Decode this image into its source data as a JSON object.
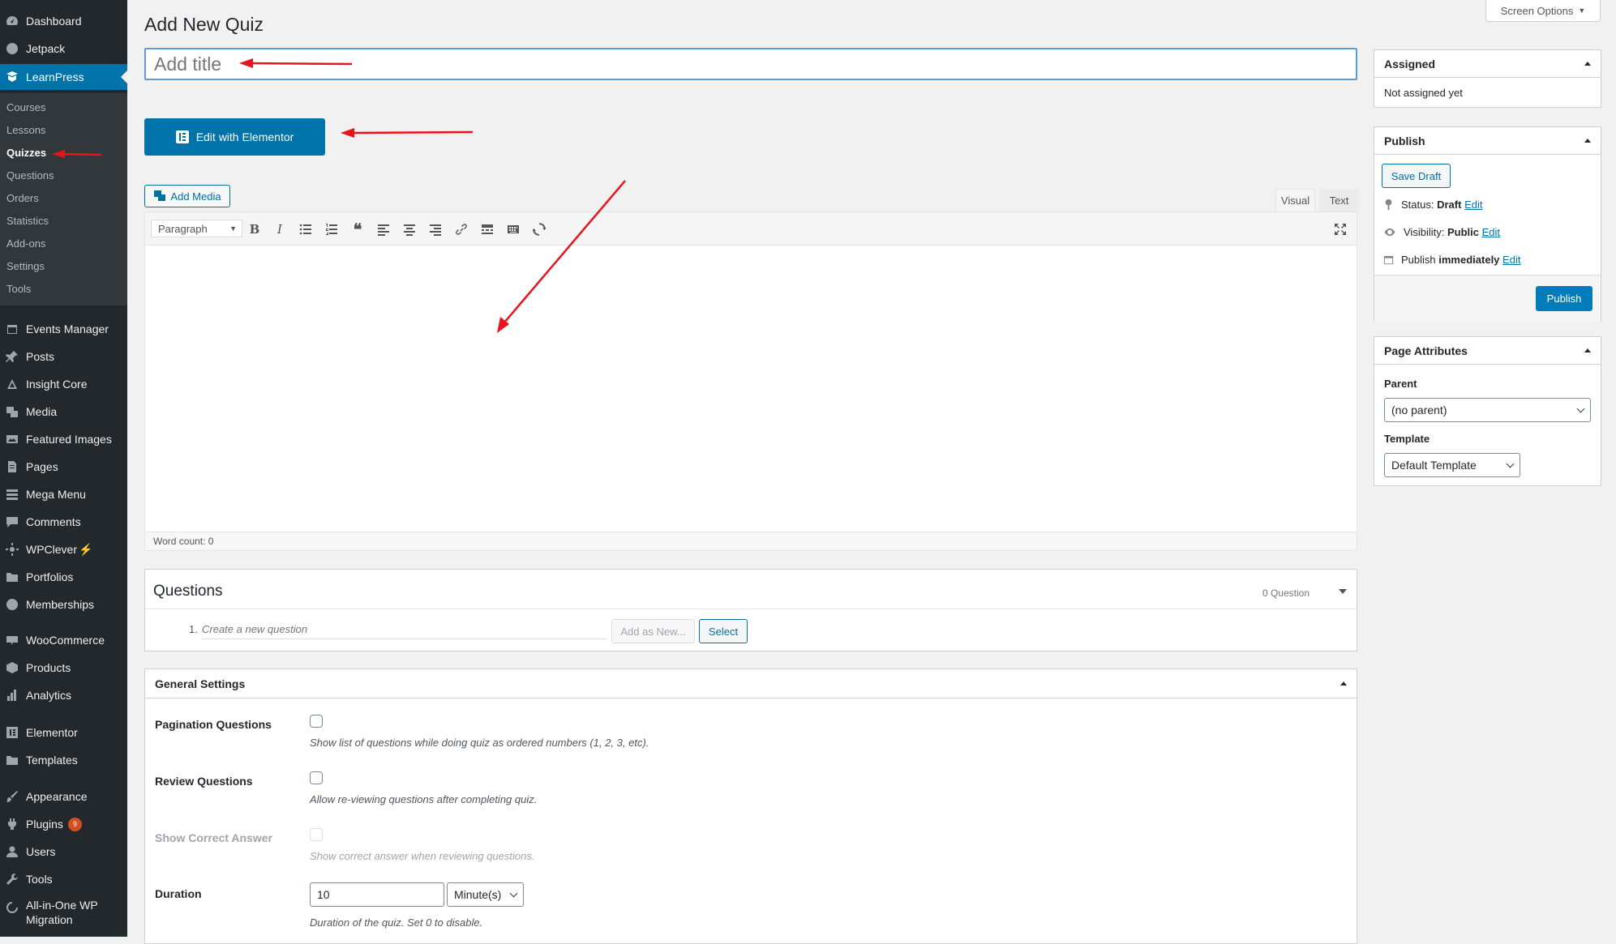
{
  "sidebar": {
    "items": [
      {
        "label": "Dashboard",
        "icon": "dashboard-icon"
      },
      {
        "label": "Jetpack",
        "icon": "jetpack-icon"
      },
      {
        "label": "LearnPress",
        "icon": "learnpress-icon"
      },
      {
        "label": "Events Manager",
        "icon": "calendar-icon"
      },
      {
        "label": "Posts",
        "icon": "pin-icon"
      },
      {
        "label": "Insight Core",
        "icon": "insight-core-icon"
      },
      {
        "label": "Media",
        "icon": "media-icon"
      },
      {
        "label": "Featured Images",
        "icon": "images-icon"
      },
      {
        "label": "Pages",
        "icon": "pages-icon"
      },
      {
        "label": "Mega Menu",
        "icon": "menu-icon"
      },
      {
        "label": "Comments",
        "icon": "comment-icon"
      },
      {
        "label": "WPClever",
        "icon": "wpclever-icon"
      },
      {
        "label": "Portfolios",
        "icon": "portfolio-icon"
      },
      {
        "label": "Memberships",
        "icon": "memberships-icon"
      },
      {
        "label": "WooCommerce",
        "icon": "woocommerce-icon"
      },
      {
        "label": "Products",
        "icon": "products-icon"
      },
      {
        "label": "Analytics",
        "icon": "analytics-icon"
      },
      {
        "label": "Elementor",
        "icon": "elementor-icon"
      },
      {
        "label": "Templates",
        "icon": "folder-icon"
      },
      {
        "label": "Appearance",
        "icon": "brush-icon"
      },
      {
        "label": "Plugins",
        "icon": "plugin-icon",
        "badge": "9"
      },
      {
        "label": "Users",
        "icon": "user-icon"
      },
      {
        "label": "Tools",
        "icon": "wrench-icon"
      },
      {
        "label": "All-in-One WP",
        "label2": "Migration",
        "icon": "migration-icon"
      }
    ],
    "submenu": [
      "Courses",
      "Lessons",
      "Quizzes",
      "Questions",
      "Orders",
      "Statistics",
      "Add-ons",
      "Settings",
      "Tools"
    ],
    "current_submenu": "Quizzes"
  },
  "header": {
    "title": "Add New Quiz",
    "screen_options": "Screen Options"
  },
  "title_field": {
    "placeholder": "Add title",
    "value": ""
  },
  "elementor_button": "Edit with Elementor",
  "editor": {
    "add_media": "Add Media",
    "tabs": {
      "visual": "Visual",
      "text": "Text"
    },
    "format": "Paragraph",
    "word_count": "Word count: 0"
  },
  "questions": {
    "title": "Questions",
    "count": "0 Question",
    "number": "1.",
    "new_placeholder": "Create a new question",
    "add_as_new": "Add as New...",
    "select": "Select"
  },
  "general_settings": {
    "title": "General Settings",
    "pagination": {
      "label": "Pagination Questions",
      "desc": "Show list of questions while doing quiz as ordered numbers (1, 2, 3, etc)."
    },
    "review": {
      "label": "Review Questions",
      "desc": "Allow re-viewing questions after completing quiz."
    },
    "correct": {
      "label": "Show Correct Answer",
      "desc": "Show correct answer when reviewing questions."
    },
    "duration": {
      "label": "Duration",
      "value": "10",
      "unit": "Minute(s)",
      "desc": "Duration of the quiz. Set 0 to disable."
    }
  },
  "assigned": {
    "title": "Assigned",
    "text": "Not assigned yet"
  },
  "publish": {
    "title": "Publish",
    "save_draft": "Save Draft",
    "status_label": "Status:",
    "status_value": "Draft",
    "visibility_label": "Visibility:",
    "visibility_value": "Public",
    "publish_label": "Publish",
    "publish_value": "immediately",
    "edit": "Edit",
    "button": "Publish"
  },
  "page_attributes": {
    "title": "Page Attributes",
    "parent_label": "Parent",
    "parent_value": "(no parent)",
    "template_label": "Template",
    "template_value": "Default Template"
  },
  "colors": {
    "accent": "#0073aa",
    "annotation_arrow": "#e8141b",
    "sidebar_bg": "#23282d"
  }
}
